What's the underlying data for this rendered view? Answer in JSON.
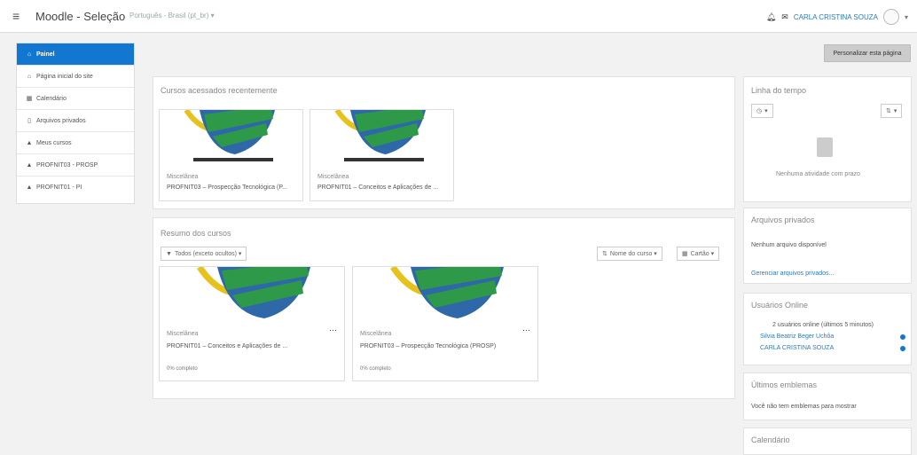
{
  "navbar": {
    "site_name": "Moodle - Seleção",
    "language": "Português - Brasil (pt_br) ▾",
    "user_name": "CARLA CRISTINA SOUZA"
  },
  "sidebar": {
    "items": [
      {
        "label": "Painel",
        "icon": "dashboard-icon",
        "active": true
      },
      {
        "label": "Página inicial do site",
        "icon": "home-icon"
      },
      {
        "label": "Calendário",
        "icon": "calendar-icon"
      },
      {
        "label": "Arquivos privados",
        "icon": "file-icon"
      },
      {
        "label": "Meus cursos",
        "icon": "graduation-cap-icon"
      },
      {
        "label": "PROFNIT03 - PROSP",
        "icon": "graduation-cap-icon"
      },
      {
        "label": "PROFNIT01 - PI",
        "icon": "graduation-cap-icon"
      }
    ]
  },
  "toolbar": {
    "customize_label": "Personalizar esta página"
  },
  "recent": {
    "title": "Cursos acessados recentemente",
    "courses": [
      {
        "category": "Miscelânea",
        "name": "PROFNIT03 – Prospecção Tecnológica (P..."
      },
      {
        "category": "Miscelânea",
        "name": "PROFNIT01 – Conceitos e Aplicações de ..."
      }
    ]
  },
  "overview": {
    "title": "Resumo dos cursos",
    "filter_label": "Todos (exceto ocultos) ▾",
    "sort_label": "Nome do curso ▾",
    "view_label": "Cartão ▾",
    "courses": [
      {
        "category": "Miscelânea",
        "name": "PROFNIT01 – Conceitos e Aplicações de ...",
        "progress": "0% completo"
      },
      {
        "category": "Miscelânea",
        "name": "PROFNIT03 – Prospecção Tecnológica (PROSP)",
        "progress": "0% completo"
      }
    ]
  },
  "timeline": {
    "title": "Linha do tempo",
    "empty": "Nenhuma atividade com prazo"
  },
  "private_files": {
    "title": "Arquivos privados",
    "empty": "Nenhum arquivo disponível",
    "manage_link": "Gerenciar arquivos privados..."
  },
  "online_users": {
    "title": "Usuários Online",
    "summary": "2 usuários online (últimos 5 minutos)",
    "users": [
      "Silvia Beatriz Beger Uchôa",
      "CARLA CRISTINA SOUZA"
    ]
  },
  "badges": {
    "title": "Últimos emblemas",
    "empty": "Você não tem emblemas para mostrar"
  },
  "calendar": {
    "title": "Calendário"
  },
  "colors": {
    "accent": "#1177d1",
    "logo_green": "#2e9a49",
    "logo_blue": "#2f68a8",
    "logo_yellow": "#e6c21b"
  }
}
